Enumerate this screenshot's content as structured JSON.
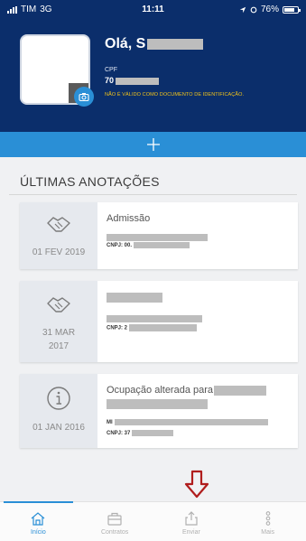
{
  "status_bar": {
    "carrier": "TIM",
    "network": "3G",
    "time": "11:11",
    "battery": "76%"
  },
  "profile": {
    "greeting": "Olá, S",
    "cpf_label": "CPF",
    "cpf_value": "70",
    "warning": "NÃO É VÁLIDO COMO DOCUMENTO DE IDENTIFICAÇÃO."
  },
  "section": {
    "title": "ÚLTIMAS ANOTAÇÕES"
  },
  "cards": [
    {
      "icon": "handshake-icon",
      "date": "01 FEV 2019",
      "title": "Admissão",
      "cnpj": "CNPJ: 00."
    },
    {
      "icon": "handshake-icon",
      "date_line1": "31 MAR",
      "date_line2": "2017",
      "cnpj": "CNPJ: 2"
    },
    {
      "icon": "info-icon",
      "date": "01 JAN 2016",
      "title": "Ocupação alterada para",
      "mi": "MI",
      "cnpj": "CNPJ: 37"
    }
  ],
  "nav": [
    {
      "label": "Início",
      "icon": "home-icon",
      "active": true
    },
    {
      "label": "Contratos",
      "icon": "briefcase-icon",
      "active": false
    },
    {
      "label": "Enviar",
      "icon": "share-icon",
      "active": false
    },
    {
      "label": "Mais",
      "icon": "more-icon",
      "active": false
    }
  ],
  "colors": {
    "header_bg": "#0b2e6b",
    "accent": "#2a8fd6",
    "warning_text": "#f5c518",
    "arrow": "#b01d1d"
  }
}
